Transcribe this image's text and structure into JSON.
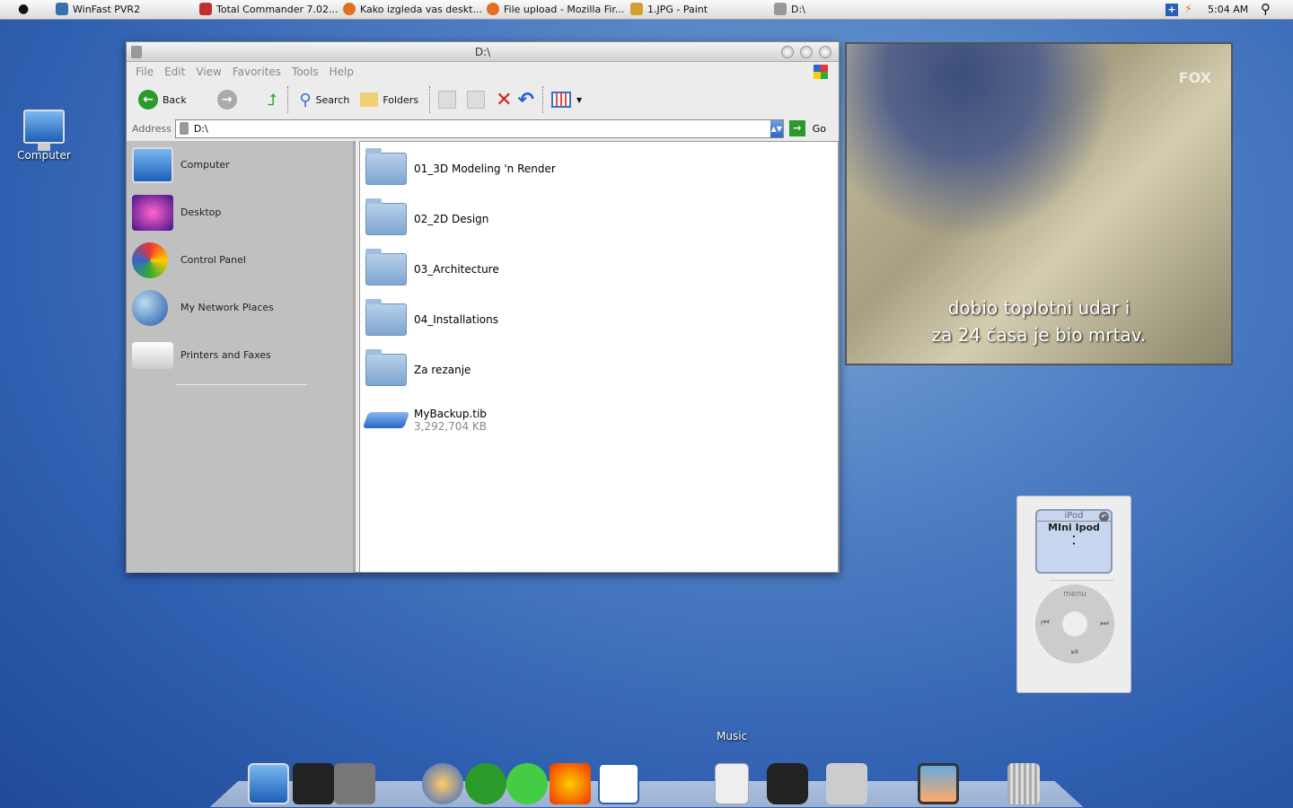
{
  "menubar": {
    "tasks": [
      {
        "label": "WinFast PVR2",
        "color": "#3a6fb0"
      },
      {
        "label": "Total Commander 7.02...",
        "color": "#c03030"
      },
      {
        "label": "Kako izgleda vas deskt...",
        "color": "#e07020"
      },
      {
        "label": "File upload - Mozilla Fir...",
        "color": "#e07020"
      },
      {
        "label": "1.JPG - Paint",
        "color": "#d0a030"
      },
      {
        "label": "D:\\",
        "color": "#999999"
      }
    ],
    "clock": "5:04 AM"
  },
  "desktop": {
    "computer_label": "Computer"
  },
  "explorer": {
    "title": "D:\\",
    "menus": [
      "File",
      "Edit",
      "View",
      "Favorites",
      "Tools",
      "Help"
    ],
    "toolbar": {
      "back": "Back",
      "search": "Search",
      "folders": "Folders"
    },
    "address_label": "Address",
    "address_value": "D:\\",
    "go": "Go",
    "places": [
      "Computer",
      "Desktop",
      "Control Panel",
      "My Network Places",
      "Printers and Faxes"
    ],
    "files": [
      {
        "name": "01_3D Modeling 'n Render"
      },
      {
        "name": "02_2D Design"
      },
      {
        "name": "03_Architecture"
      },
      {
        "name": "04_Installations"
      },
      {
        "name": "Za rezanje"
      }
    ],
    "backup": {
      "name": "MyBackup.tib",
      "size": "3,292,704 KB"
    }
  },
  "video": {
    "logo": "FOX",
    "line1": "dobio toplotni udar i",
    "line2": "za 24 časa je bio mrtav."
  },
  "ipod": {
    "header": "iPod",
    "title": "MIni Ipod",
    "dot1": "•",
    "dot2": "•",
    "menu": "menu",
    "prev": "⏮",
    "next": "⏭",
    "play": "⏯"
  },
  "dock": {
    "tooltip": "Music"
  }
}
